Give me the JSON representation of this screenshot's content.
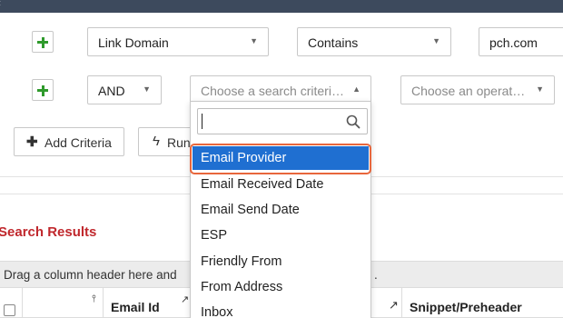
{
  "criteria": {
    "row1": {
      "field": "Link Domain",
      "operator": "Contains",
      "value": "pch.com"
    },
    "row2": {
      "logic": "AND",
      "field_placeholder": "Choose a search criteri…",
      "operator_placeholder": "Choose an operat…"
    }
  },
  "actions": {
    "add_criteria_label": "Add Criteria",
    "run_label": "Run"
  },
  "results": {
    "title": "Search Results",
    "group_hint": "Drag a column header here and",
    "group_hint_tail": ".",
    "columns": [
      {
        "label": "Email Id"
      },
      {
        "label": "Snippet/Preheader"
      }
    ]
  },
  "dropdown": {
    "search_value": "",
    "selected": "Email Provider",
    "options": [
      "Email Provider",
      "Email Received Date",
      "Email Send Date",
      "ESP",
      "Friendly From",
      "From Address",
      "Inbox"
    ]
  },
  "colors": {
    "accent_green": "#2f9a2c",
    "results_red": "#c0282d",
    "selection_blue": "#1f6fd1",
    "highlight_ring": "#e8663c",
    "topbar": "#3d4a5d"
  },
  "icons": {
    "add_row": "plus-icon",
    "add_criteria": "plus-icon",
    "run": "bolt-icon",
    "search": "search-icon",
    "caret": "caret-down-icon",
    "pin": "pin-icon"
  }
}
